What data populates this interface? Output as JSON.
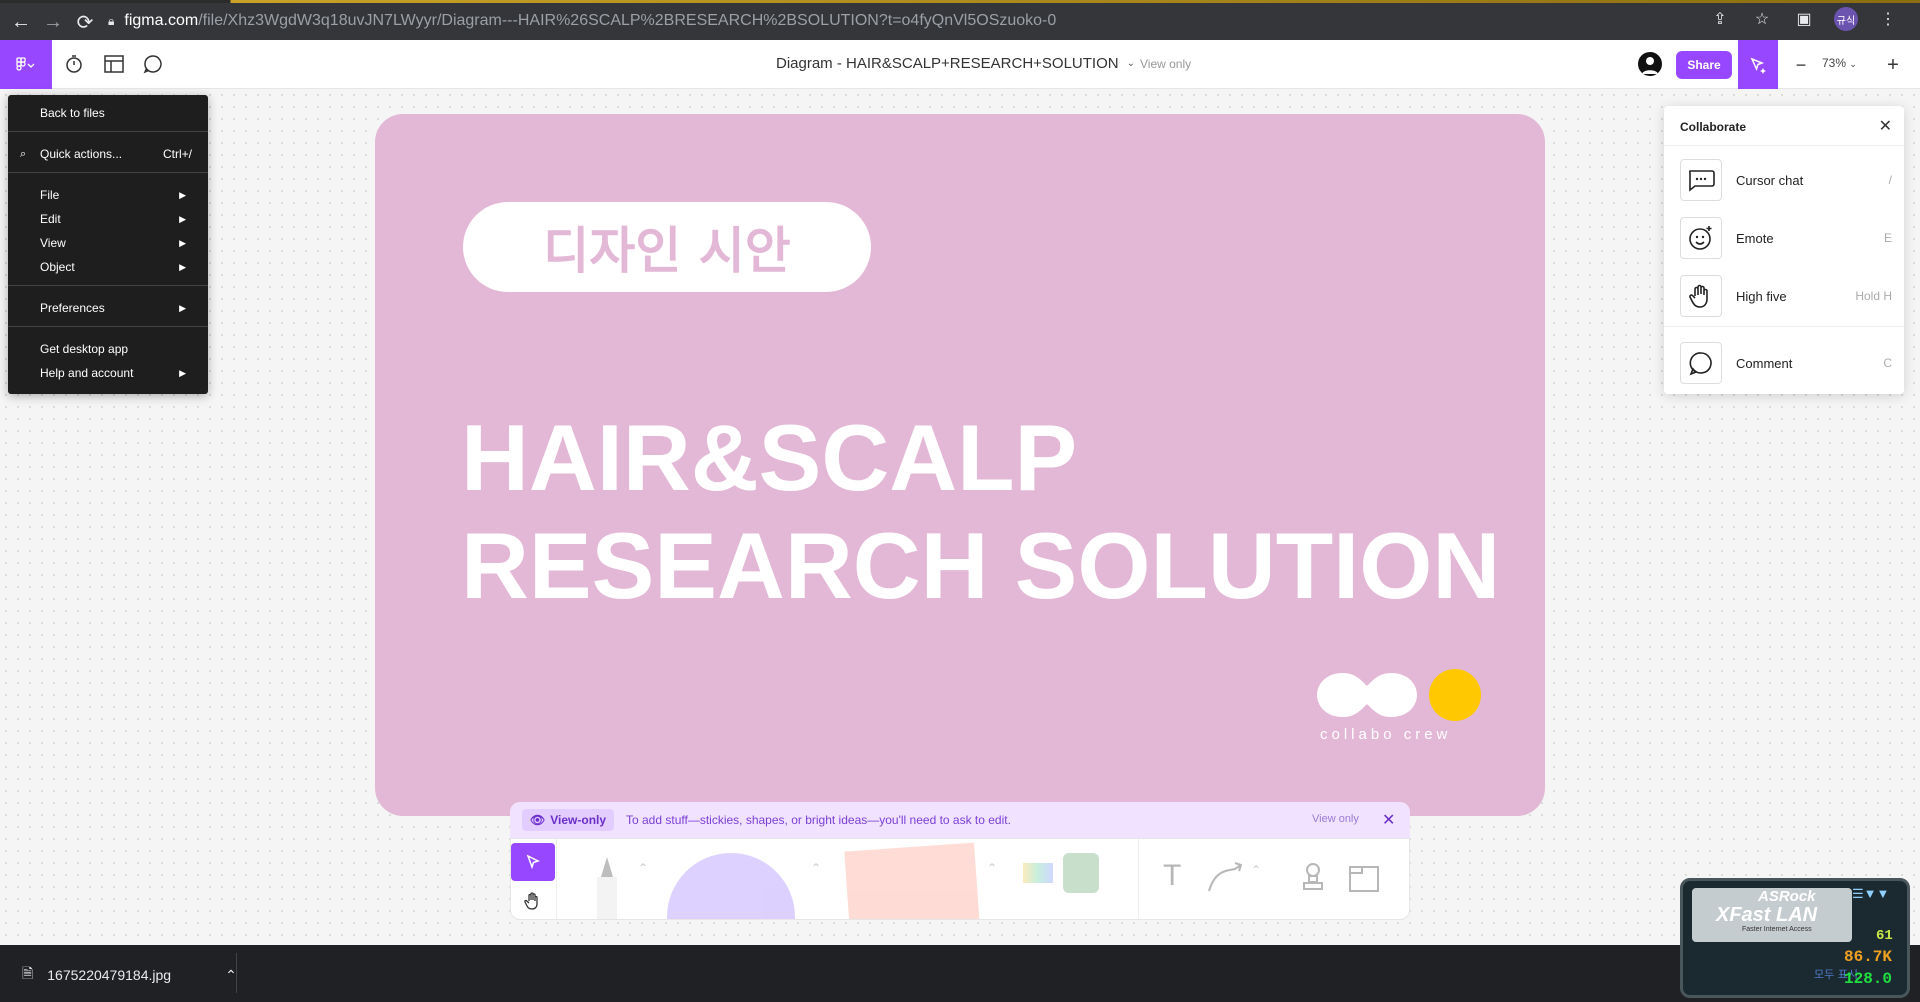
{
  "browser": {
    "url_domain": "figma.com",
    "url_path": "/file/Xhz3WgdW3q18uvJN7LWyyr/Diagram---HAIR%26SCALP%2BRESEARCH%2BSOLUTION?t=o4fyQnVl5OSzuoko-0",
    "profile_label": "규식"
  },
  "figma": {
    "doc_title": "Diagram - HAIR&SCALP+RESEARCH+SOLUTION",
    "view_only_label": "View only",
    "share_label": "Share",
    "zoom": "73%"
  },
  "menu": {
    "items": [
      {
        "label": "Back to files"
      },
      {
        "label": "Quick actions...",
        "shortcut": "Ctrl+/"
      },
      {
        "label": "File"
      },
      {
        "label": "Edit"
      },
      {
        "label": "View"
      },
      {
        "label": "Object"
      },
      {
        "label": "Preferences"
      },
      {
        "label": "Get desktop app"
      },
      {
        "label": "Help and account"
      }
    ]
  },
  "collaborate": {
    "title": "Collaborate",
    "items": [
      {
        "label": "Cursor chat",
        "key": "/"
      },
      {
        "label": "Emote",
        "key": "E"
      },
      {
        "label": "High five",
        "key": "Hold H"
      },
      {
        "label": "Comment",
        "key": "C"
      }
    ]
  },
  "slide": {
    "pill_text": "디자인 시안",
    "title_line1": "HAIR&SCALP",
    "title_line2": "RESEARCH SOLUTION",
    "logo_text": "collabo crew",
    "bg_color": "#e3b8d6",
    "accent_color": "#ffc800"
  },
  "notice": {
    "badge": "View-only",
    "text": "To add stuff—stickies, shapes, or bright ideas—you'll need to ask to edit.",
    "right_label": "View only"
  },
  "download": {
    "filename": "1675220479184.jpg"
  },
  "widget": {
    "brand": "ASRock",
    "product": "XFast LAN",
    "tagline": "Faster Internet Access",
    "label_korean": "모두 표시",
    "value1": "61",
    "value2": "86.7K",
    "value3": "128.0"
  }
}
